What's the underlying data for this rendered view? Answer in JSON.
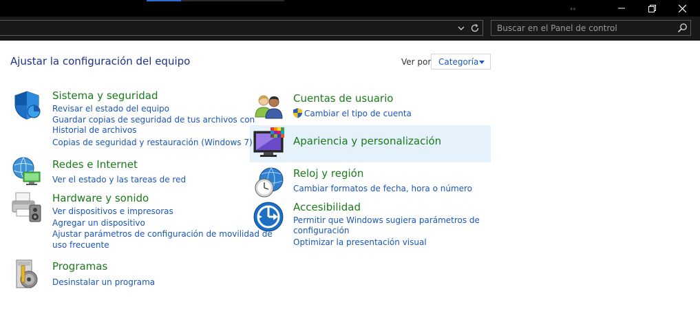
{
  "window": {
    "minimize_glyph": "—",
    "maximize_glyph": "❐",
    "close_glyph": "✕",
    "resize_glyph": "↔"
  },
  "address_bar": {
    "path": "",
    "search_placeholder": "Buscar en el Panel de control"
  },
  "page": {
    "title": "Ajustar la configuración del equipo",
    "view_by_label": "Ver por:",
    "view_by_value": "Categoría"
  },
  "categories": [
    {
      "heading": "Sistema y seguridad",
      "icon": "shield-icon",
      "links": [
        "Revisar el estado del equipo",
        "Guardar copias de seguridad de tus archivos con",
        "Historial de archivos",
        "Copias de seguridad y restauración (Windows 7)"
      ]
    },
    {
      "heading": "Redes e Internet",
      "icon": "network-globe-icon",
      "links": [
        "Ver el estado y las tareas de red"
      ]
    },
    {
      "heading": "Hardware y sonido",
      "icon": "printer-speaker-icon",
      "links": [
        "Ver dispositivos e impresoras",
        "Agregar un dispositivo",
        "Ajustar parámetros de configuración de movilidad de",
        "uso frecuente"
      ]
    },
    {
      "heading": "Programas",
      "icon": "programs-disc-icon",
      "links": [
        "Desinstalar un programa"
      ]
    },
    {
      "heading": "Cuentas de usuario",
      "icon": "users-icon",
      "links": [
        "Cambiar el tipo de cuenta"
      ]
    },
    {
      "heading": "Apariencia y personalización",
      "icon": "monitor-palette-icon",
      "links": []
    },
    {
      "heading": "Reloj y región",
      "icon": "clock-globe-icon",
      "links": [
        "Cambiar formatos de fecha, hora o número"
      ]
    },
    {
      "heading": "Accesibilidad",
      "icon": "accessibility-icon",
      "links": [
        "Permitir que Windows sugiera parámetros de",
        "configuración",
        "Optimizar la presentación visual"
      ]
    }
  ],
  "colors": {
    "heading_green": "#1b7a1b",
    "link_blue": "#1a56b8",
    "title_blue": "#1e3287",
    "hover_bg": "#e5f1fb"
  }
}
